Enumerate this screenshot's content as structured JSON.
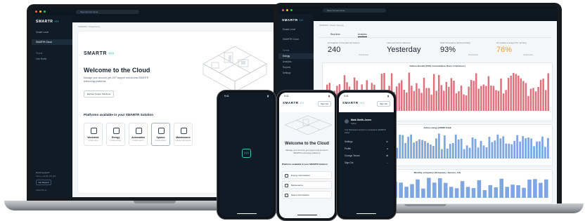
{
  "colors": {
    "navy": "#0f1b26",
    "teal": "#39c6b3",
    "orange": "#f2a034",
    "bar_red": "#e0707c",
    "bar_blue": "#7ea6e0"
  },
  "browser": {
    "url": "https://smartr.cloud"
  },
  "brand": {
    "name": "SMARTR",
    "chevrons": "›››"
  },
  "left_laptop": {
    "sidebar": {
      "items": [
        "Smartr Level",
        "SMARTR Cloud"
      ],
      "section": "Global",
      "item_active": "Live Home"
    },
    "breadcrumb": "SMARTR / Cloud home",
    "welcome_title": "Welcome to the Cloud",
    "welcome_text": "Manage your account, get 24/7 support and access SMARTR technology platforms.",
    "explore_button": "Explore Smartr Solutions",
    "platforms_title": "Platforms available in your SMARTR Solution",
    "tiles": [
      {
        "label": "Workdesk",
        "sub": "Include apps",
        "icon": "gear-icon"
      },
      {
        "label": "Energy",
        "sub": "Include energy",
        "icon": "bolt-icon"
      },
      {
        "label": "Automation",
        "sub": "Include control",
        "icon": "infinity-icon"
      },
      {
        "label": "Spaces",
        "sub": "Include spaces",
        "icon": "cube-icon"
      },
      {
        "label": "Maintenance",
        "sub": "Include maintenance",
        "icon": "wrench-icon"
      }
    ],
    "footer_links": [
      "Need support?",
      "Call us +44 000 000 000",
      "Get Support",
      "SMARTR Ltd"
    ]
  },
  "right_laptop": {
    "sidebar": {
      "items": [
        "Smartr Level",
        "SMARTR Cloud"
      ],
      "section": "Global",
      "nav": [
        "Energy",
        "Analytics",
        "Reports",
        "Settings"
      ]
    },
    "breadcrumb": "SMARTR / Cloud / Energy",
    "tabs": [
      "Real-time",
      "Analytics"
    ],
    "kpis": [
      {
        "label": "Occupation of the planned system",
        "value": "240",
        "note": "Vs 24 hours"
      },
      {
        "label": "Last occurrence detected",
        "value": "Yesterday",
        "note": ""
      },
      {
        "label": "Total Occupancy (planned-data)",
        "value": "93%",
        "note": "Vs 24 hours"
      },
      {
        "label": "Air Quality average this morning",
        "value": "76%",
        "note": "Vs 24 hours"
      }
    ],
    "charts": [
      {
        "title": "Carbon dioxide (CO2) concentration (Zone 1.3 Environ.)"
      },
      {
        "title": "Active energy (15MIN Total)"
      },
      {
        "title": "Monthly occupancy (Occupancy_Sensors_1/4)"
      }
    ]
  },
  "phone_left": {
    "time": "9:41"
  },
  "phone_center": {
    "time": "9:41",
    "signin": "Sign Out",
    "welcome_title": "Welcome to the Cloud",
    "welcome_text": "Manage your account, get support and access to SMARTR technology platforms.",
    "platforms_title": "Platforms available in your SMARTR Solution",
    "rows": [
      "Energy Optimisation",
      "Maintenance",
      "Space Optimisation"
    ]
  },
  "phone_right": {
    "time": "9:41",
    "signin": "Sign Out",
    "user_name": "Mark Smith-Jones",
    "user_role": "Admin",
    "user_note": "Your Workspace Account is connected to SMARTR Cloud",
    "menu": [
      "Settings",
      "Profile",
      "Change Tenant",
      "Sign Out"
    ]
  }
}
